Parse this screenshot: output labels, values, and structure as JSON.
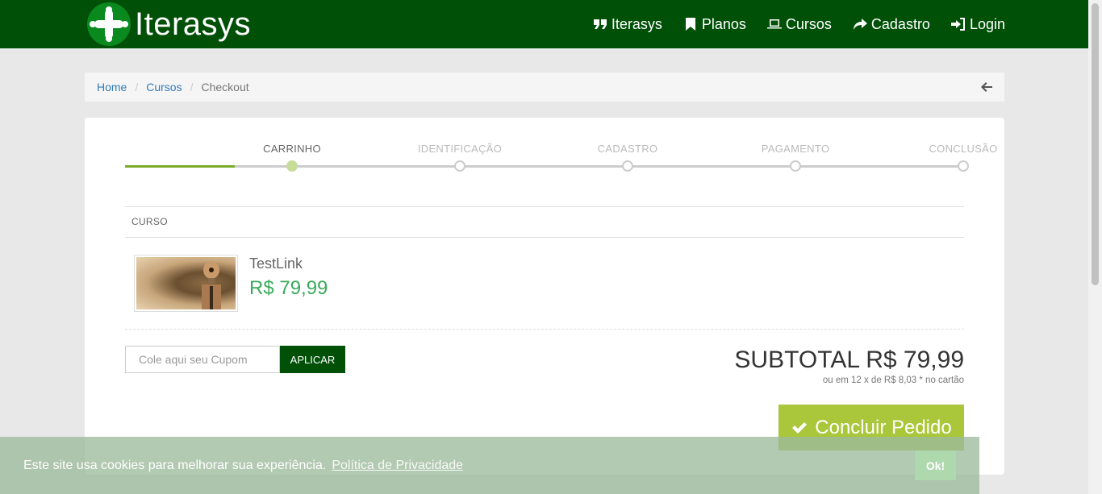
{
  "header": {
    "brand": "Iterasys",
    "nav": [
      {
        "label": "Iterasys",
        "icon": "quote-icon"
      },
      {
        "label": "Planos",
        "icon": "bookmark-icon"
      },
      {
        "label": "Cursos",
        "icon": "laptop-icon"
      },
      {
        "label": "Cadastro",
        "icon": "share-icon"
      },
      {
        "label": "Login",
        "icon": "sign-in-icon"
      }
    ],
    "color": "#005007"
  },
  "breadcrumb": {
    "items": [
      "Home",
      "Cursos"
    ],
    "current": "Checkout",
    "back_icon": "arrow-left-icon"
  },
  "checkout": {
    "steps": [
      "CARRINHO",
      "IDENTIFICAÇÃO",
      "CADASTRO",
      "PAGAMENTO",
      "CONCLUSÃO"
    ],
    "active_step": "CARRINHO",
    "table_header": "CURSO",
    "course": {
      "name": "TestLink",
      "price": "R$ 79,99"
    },
    "coupon": {
      "placeholder": "Cole aqui seu Cupom",
      "button": "APLICAR"
    },
    "subtotal": "SUBTOTAL R$ 79,99",
    "installments": "ou em 12 x de R$ 8,03 * no cartão",
    "finish_button": "Concluir Pedido",
    "accent_color": "#aac63a",
    "price_color": "#3aaa5a"
  },
  "cookie": {
    "text": "Este site usa cookies para melhorar sua experiência.",
    "link": "Política de Privacidade",
    "ok": "Ok!"
  }
}
